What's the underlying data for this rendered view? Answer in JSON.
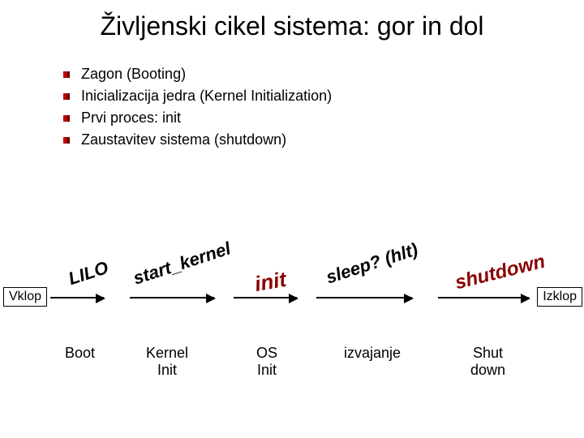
{
  "title": "Življenski cikel sistema: gor in dol",
  "bullets": [
    "Zagon (Booting)",
    "Inicializacija jedra (Kernel Initialization)",
    "Prvi proces: init",
    "Zaustavitev sistema (shutdown)"
  ],
  "diagram": {
    "start_box": "Vklop",
    "end_box": "Izklop",
    "phases": [
      "Boot",
      "Kernel\nInit",
      "OS\nInit",
      "izvajanje",
      "Shut\ndown"
    ],
    "arrow_labels": {
      "lilo": "LILO",
      "start_kernel": "start_kernel",
      "init": "init",
      "sleep": "sleep? (hlt)",
      "shutdown": "shutdown"
    },
    "colors": {
      "title": "#000000",
      "label_black": "#000000",
      "label_darkred": "#8B0000"
    }
  }
}
